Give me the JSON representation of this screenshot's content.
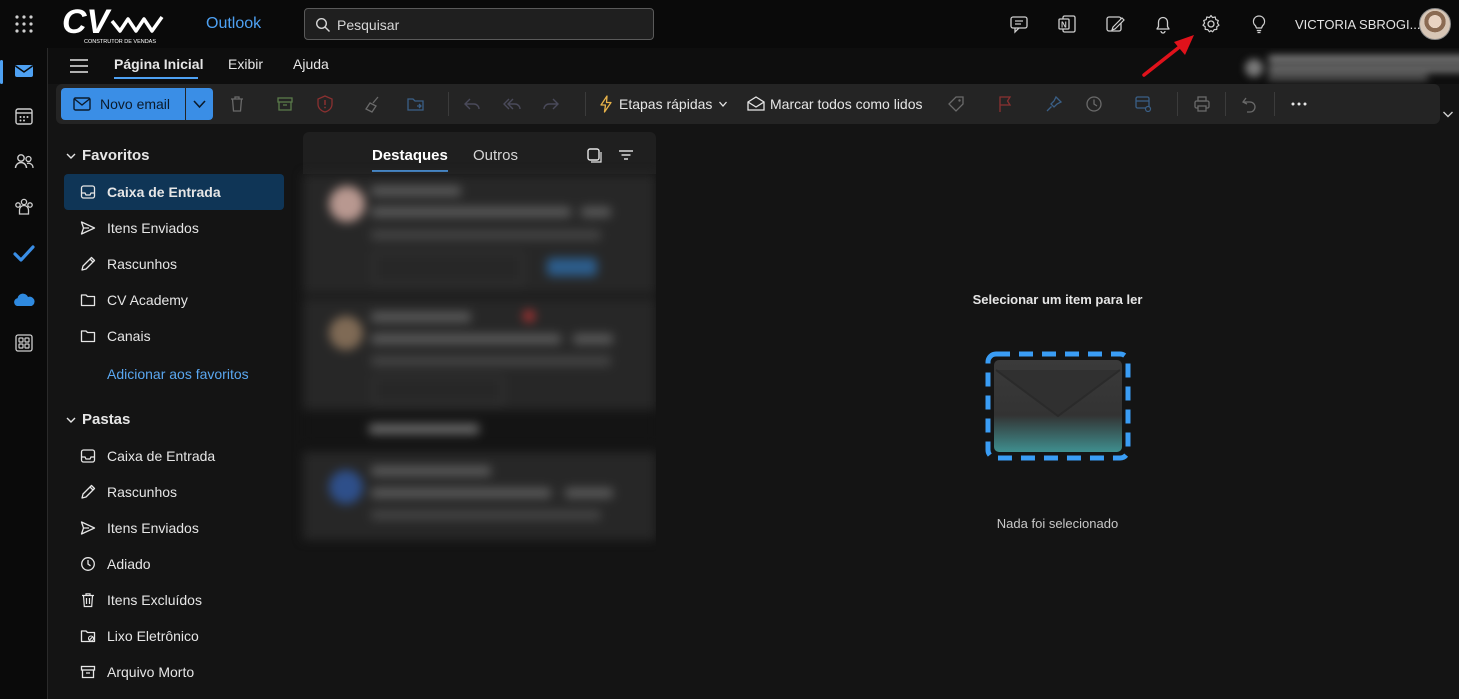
{
  "topbar": {
    "app_name": "Outlook",
    "search_placeholder": "Pesquisar",
    "user_name": "VICTORIA SBROGI...",
    "logo_text": "CV",
    "logo_subtitle": "CONSTRUTOR DE VENDAS"
  },
  "ribbon": {
    "tabs": [
      "Página Inicial",
      "Exibir",
      "Ajuda"
    ],
    "active_tab": "Página Inicial"
  },
  "toolbar": {
    "new_mail": "Novo email",
    "quick_steps": "Etapas rápidas",
    "mark_all_read": "Marcar todos como lidos"
  },
  "favorites": {
    "heading": "Favoritos",
    "items": [
      "Caixa de Entrada",
      "Itens Enviados",
      "Rascunhos",
      "CV Academy",
      "Canais"
    ],
    "add_link": "Adicionar aos favoritos"
  },
  "folders": {
    "heading": "Pastas",
    "items": [
      "Caixa de Entrada",
      "Rascunhos",
      "Itens Enviados",
      "Adiado",
      "Itens Excluídos",
      "Lixo Eletrônico",
      "Arquivo Morto"
    ]
  },
  "message_list": {
    "tabs": [
      "Destaques",
      "Outros"
    ],
    "active_tab": "Destaques"
  },
  "reading_pane": {
    "title": "Selecionar um item para ler",
    "subtitle": "Nada foi selecionado"
  },
  "colors": {
    "accent": "#4ea1f3",
    "primary_button": "#3a8ee6",
    "selected_folder": "#0f3556",
    "annotation_arrow": "#e0121b"
  },
  "icons": {
    "rail": [
      "mail-icon",
      "calendar-icon",
      "people-icon",
      "groups-icon",
      "todo-icon",
      "onedrive-icon",
      "apps-icon"
    ],
    "topbar": [
      "chat-icon",
      "onenote-icon",
      "compose-note-icon",
      "bell-icon",
      "gear-icon",
      "lightbulb-icon"
    ]
  }
}
